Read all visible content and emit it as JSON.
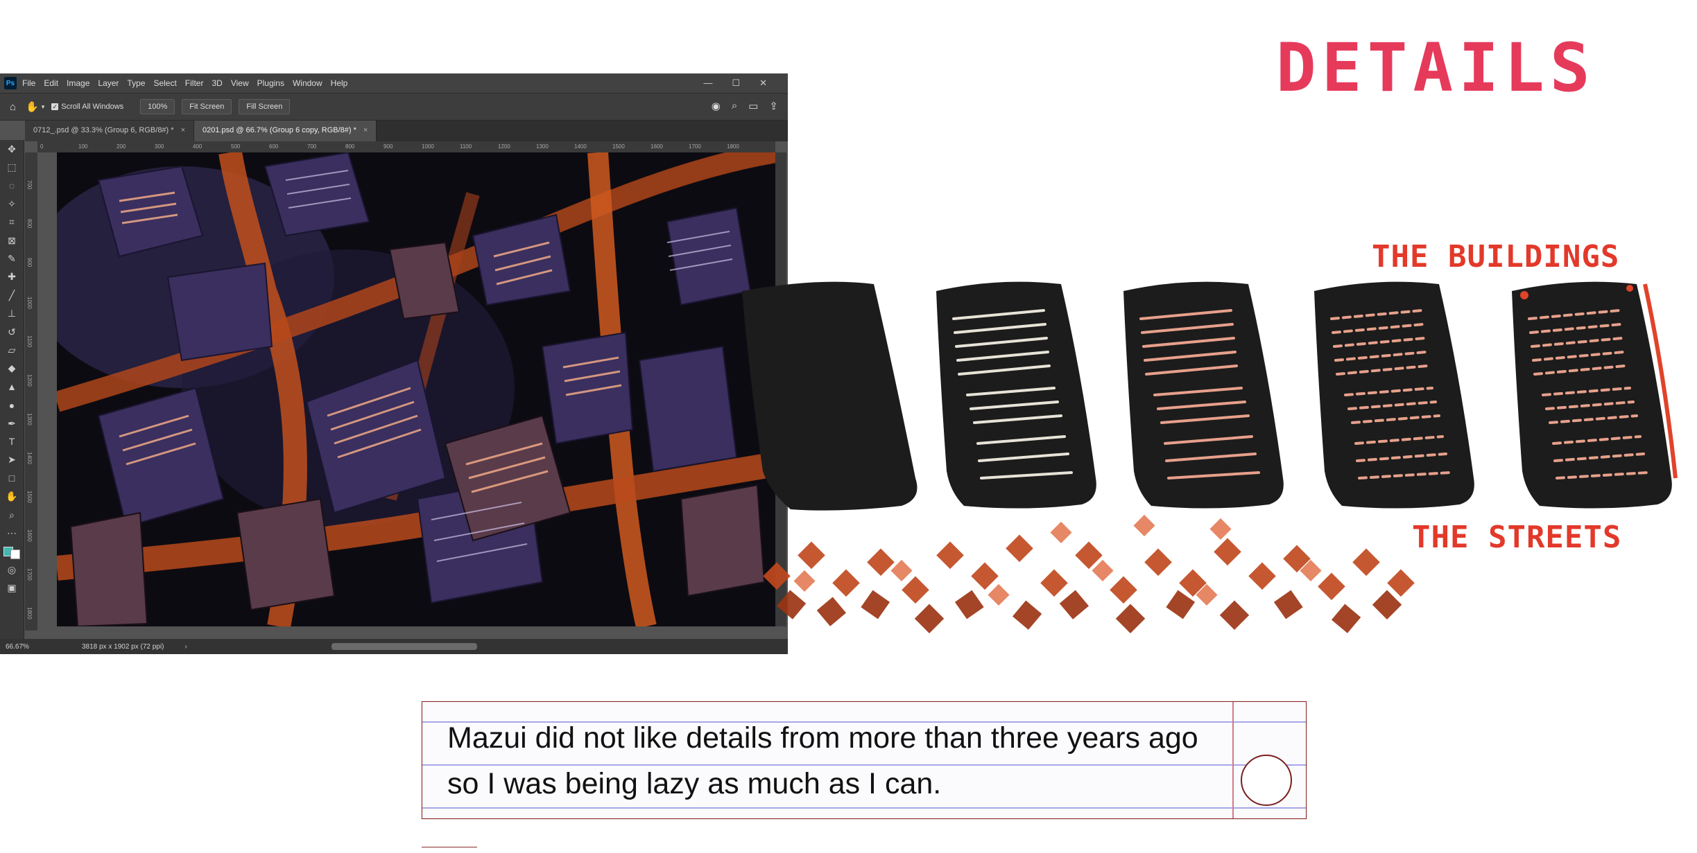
{
  "photoshop": {
    "logo": "Ps",
    "menu": [
      "File",
      "Edit",
      "Image",
      "Layer",
      "Type",
      "Select",
      "Filter",
      "3D",
      "View",
      "Plugins",
      "Window",
      "Help"
    ],
    "window_controls": [
      "—",
      "☐",
      "✕"
    ],
    "options": {
      "scroll_all_label": "Scroll All Windows",
      "zoom_value": "100%",
      "fit_screen": "Fit Screen",
      "fill_screen": "Fill Screen"
    },
    "tabs": [
      {
        "label": "0712_.psd @ 33.3% (Group 6, RGB/8#) *",
        "active": false
      },
      {
        "label": "0201.psd @ 66.7% (Group 6 copy, RGB/8#) *",
        "active": true
      }
    ],
    "ruler_top": [
      "0",
      "100",
      "200",
      "300",
      "400",
      "500",
      "600",
      "700",
      "800",
      "900",
      "1000",
      "1100",
      "1200",
      "1300",
      "1400",
      "1500",
      "1600",
      "1700",
      "1800"
    ],
    "ruler_left": [
      "700",
      "800",
      "900",
      "1000",
      "1100",
      "1200",
      "1300",
      "1400",
      "1500",
      "1600",
      "1700",
      "1800"
    ],
    "status": {
      "zoom": "66.67%",
      "doc_info": "3818 px x 1902 px (72 ppi)"
    },
    "tools": [
      "move-icon",
      "marquee-icon",
      "lasso-icon",
      "magic-wand-icon",
      "crop-icon",
      "frame-icon",
      "eyedropper-icon",
      "healing-icon",
      "brush-icon",
      "stamp-icon",
      "history-brush-icon",
      "eraser-icon",
      "bucket-icon",
      "blur-icon",
      "dodge-icon",
      "pen-icon",
      "type-icon",
      "path-select-icon",
      "rectangle-icon",
      "hand-icon",
      "zoom-icon",
      "more-icon",
      "colors-icon",
      "quickmask-icon",
      "screen-mode-icon"
    ],
    "accent_color": "#31a8ff"
  },
  "panel": {
    "title": "DETAILS",
    "buildings_label": "THE BUILDINGS",
    "streets_label": "THE STREETS",
    "title_color": "#e63a5b",
    "label_color": "#e2392a"
  },
  "note": {
    "line1": "Mazui did not like details from more than three years ago",
    "line2": "so I was being lazy as much as I can."
  }
}
